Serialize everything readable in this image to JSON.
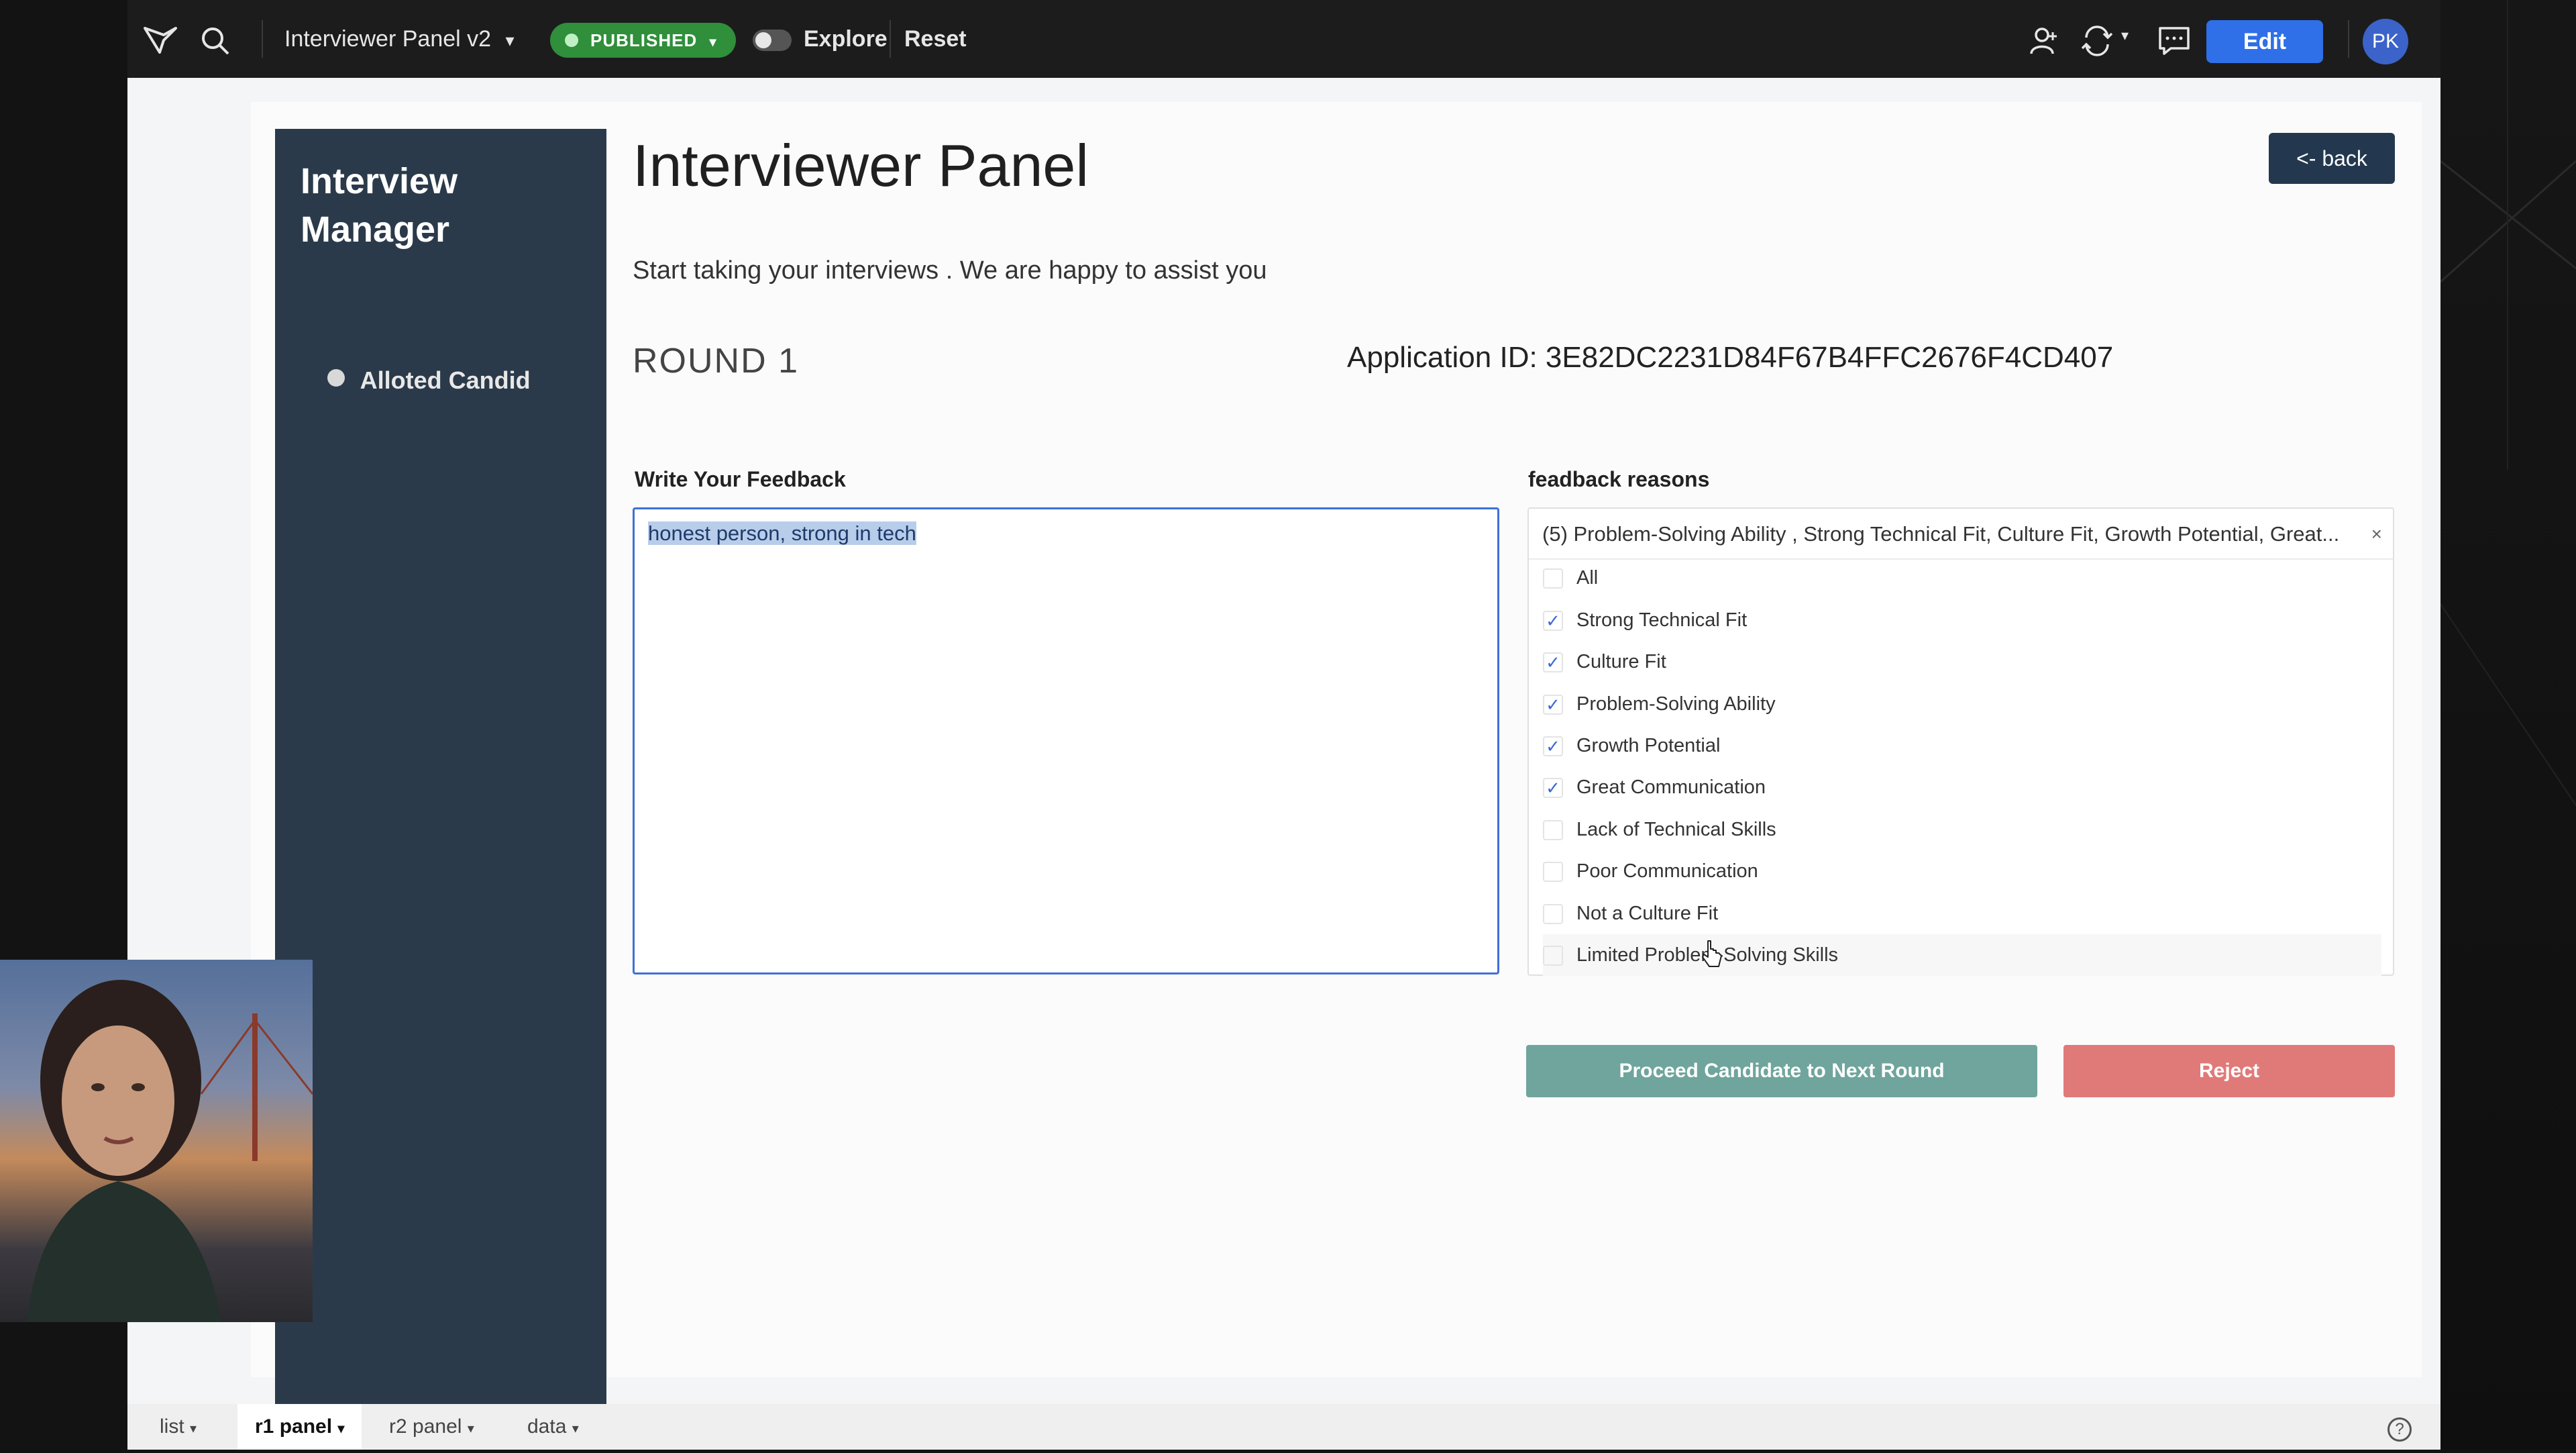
{
  "topbar": {
    "app_title": "Interviewer Panel v2",
    "status": "PUBLISHED",
    "explore_label": "Explore",
    "reset_label": "Reset",
    "edit_label": "Edit",
    "avatar_initials": "PK"
  },
  "sidebar": {
    "title": "Interview Manager",
    "items": [
      {
        "label": "Alloted Candid"
      }
    ]
  },
  "main": {
    "title": "Interviewer Panel",
    "subtitle": "Start taking your interviews . We are happy to assist you",
    "round": "ROUND 1",
    "application_id": "Application ID: 3E82DC2231D84F67B4FFC2676F4CD407",
    "back_label": "<- back"
  },
  "feedback": {
    "label": "Write Your Feedback",
    "value": "honest person, strong in tech"
  },
  "reasons": {
    "label": "feadback reasons",
    "summary": "(5) Problem-Solving Ability , Strong Technical Fit, Culture Fit, Growth Potential, Great...",
    "clear_icon": "×",
    "options": [
      {
        "label": "All",
        "checked": false
      },
      {
        "label": "Strong Technical Fit",
        "checked": true
      },
      {
        "label": "Culture Fit",
        "checked": true
      },
      {
        "label": "Problem-Solving Ability",
        "checked": true
      },
      {
        "label": "Growth Potential",
        "checked": true
      },
      {
        "label": "Great Communication",
        "checked": true
      },
      {
        "label": "Lack of Technical Skills",
        "checked": false
      },
      {
        "label": "Poor Communication",
        "checked": false
      },
      {
        "label": "Not a Culture Fit",
        "checked": false
      },
      {
        "label": "Limited Problem-Solving Skills",
        "checked": false
      }
    ]
  },
  "actions": {
    "proceed_label": "Proceed Candidate to Next Round",
    "reject_label": "Reject"
  },
  "bottom_tabs": [
    {
      "label": "list"
    },
    {
      "label": "r1 panel"
    },
    {
      "label": "r2 panel"
    },
    {
      "label": "data"
    }
  ],
  "icons": {
    "check": "✓",
    "caret": "▾",
    "help": "?"
  },
  "colors": {
    "sidebar_bg": "#2b3a4a",
    "proceed": "#6fa59c",
    "reject": "#e07a78",
    "edit": "#2f6fe8",
    "published": "#2f8f3a"
  }
}
